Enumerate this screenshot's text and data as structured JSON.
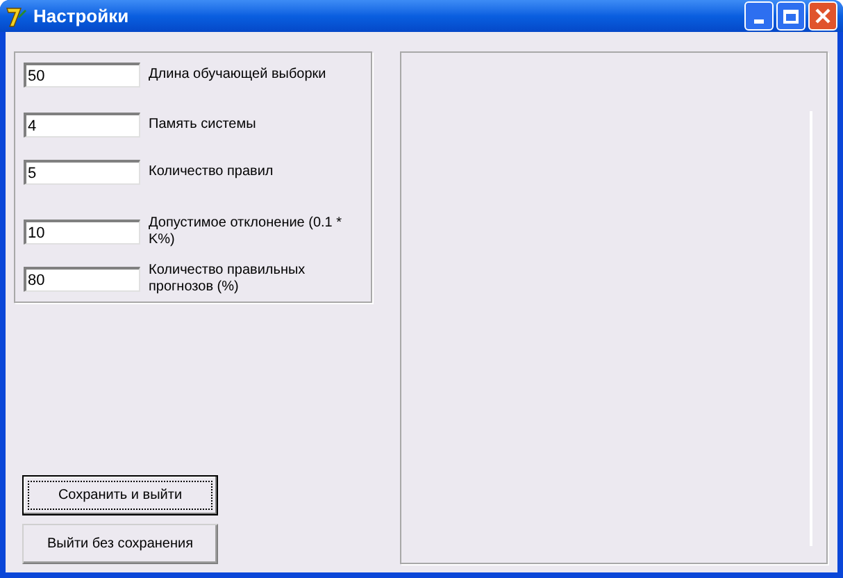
{
  "window": {
    "title": "Настройки"
  },
  "fields": [
    {
      "value": "50",
      "label": "Длина обучающей выборки"
    },
    {
      "value": "4",
      "label": "Память системы"
    },
    {
      "value": "5",
      "label": "Количество правил"
    },
    {
      "value": "10",
      "label": "Допустимое отклонение (0.1 * K%)"
    },
    {
      "value": "80",
      "label": "Количество правильных прогнозов (%)"
    }
  ],
  "buttons": [
    {
      "label": "Сохранить и выйти",
      "default": true
    },
    {
      "label": "Выйти без сохранения",
      "default": false
    }
  ]
}
